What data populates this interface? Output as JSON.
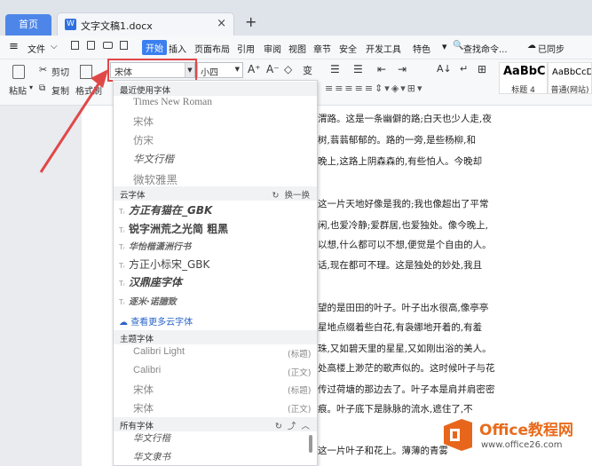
{
  "tabs": {
    "home": "首页",
    "doc_icon": "W",
    "doc": "文字文稿1.docx",
    "close": "×",
    "add": "+"
  },
  "menu": {
    "hamburger": "≡",
    "file": "文件",
    "file_caret": "⌵",
    "items": [
      "开始",
      "插入",
      "页面布局",
      "引用",
      "审阅",
      "视图",
      "章节",
      "安全",
      "开发工具",
      "特色"
    ],
    "search": "查找命令...",
    "sync": "已同步",
    "more": "▾"
  },
  "toolbar": {
    "paste": "粘贴",
    "paste_caret": "▾",
    "cut": "剪切",
    "copy": "复制",
    "brush": "格式刷",
    "font": "宋体",
    "size": "小四",
    "font_dd": "▼",
    "grow": "A⁺",
    "shrink": "A⁻",
    "clear": "◇",
    "pinyin": "变",
    "list1": "☰",
    "list2": "☰",
    "indent1": "⇤",
    "indent2": "⇥",
    "sort": "A↓",
    "para": "↵",
    "border": "⊞",
    "styles": [
      {
        "preview": "AaBbC",
        "name": "标题 4"
      },
      {
        "preview": "AaBbCcD",
        "name": "普通(网站)"
      }
    ]
  },
  "panel": {
    "recent": {
      "title": "最近使用字体",
      "fonts": [
        "Times New Roman",
        "宋体",
        "仿宋",
        "华文行楷",
        "微软雅黑"
      ]
    },
    "cloud": {
      "title": "云字体",
      "action": "换一换",
      "fonts": [
        "方正有猫在_GBK",
        "锐字洲荒之光简 粗黑",
        "华怡楷潇洲行书",
        "方正小标宋_GBK",
        "汉鼎座字体",
        "逐米·诺臆致"
      ],
      "more": "查看更多云字体"
    },
    "theme": {
      "title": "主题字体",
      "fonts": [
        {
          "name": "Calibri Light",
          "tag": "(标题)"
        },
        {
          "name": "Calibri",
          "tag": "(正文)"
        },
        {
          "name": "宋体",
          "tag": "(标题)"
        },
        {
          "name": "宋体",
          "tag": "(正文)"
        }
      ]
    },
    "all": {
      "title": "所有字体",
      "fonts": [
        "华文行楷",
        "华文隶书"
      ]
    }
  },
  "document": {
    "lines": [
      "渭路。这是一条幽僻的路;白天也少人走,夜",
      "树,蓊蓊郁郁的。路的一旁,是些杨柳,和",
      "晚上,这路上阴森森的,有些怕人。今晚却",
      "这一片天地好像是我的;我也像超出了平常",
      "闲,也爱冷静;爱群居,也爱独处。像今晚上,",
      "以想,什么都可以不想,便觉是个自由的人。",
      "话,现在都可不理。这是独处的妙处,我且",
      "望的是田田的叶子。叶子出水很高,像亭亭",
      "星地点缀着些白花,有袅娜地开着的,有羞",
      "珠,又如碧天里的星星,又如刚出浴的美人。",
      "处高楼上渺茫的歌声似的。这时候叶子与花",
      "传过荷塘的那边去了。叶子本是肩并肩密密",
      "痕。叶子底下是脉脉的流水,遮住了,不",
      "",
      "这一片叶子和花上。薄薄的青雾"
    ]
  },
  "watermark": {
    "title": "Office教程网",
    "url": "www.office26.com"
  }
}
